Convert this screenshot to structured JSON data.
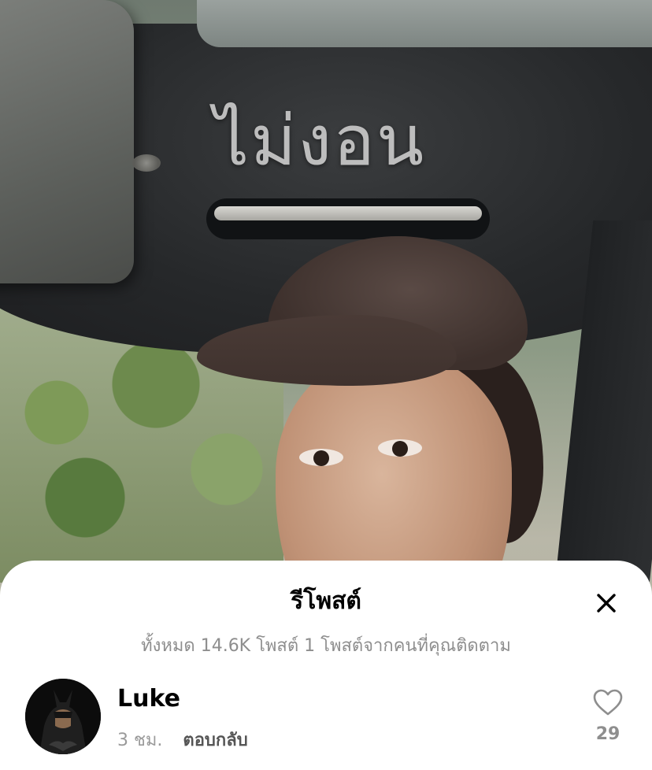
{
  "video": {
    "overlay_text": "ไม่งอน"
  },
  "sheet": {
    "title": "รีโพสต์",
    "close_icon": "close-icon",
    "subtitle": "ทั้งหมด 14.6K โพสต์ 1 โพสต์จากคนที่คุณติดตาม"
  },
  "reposts": [
    {
      "username": "Luke",
      "avatar_icon": "batman-avatar",
      "time_ago": "3 ชม.",
      "reply_label": "ตอบกลับ",
      "likes": "29",
      "like_icon": "heart-icon"
    }
  ],
  "colors": {
    "sheet_background": "#ffffff",
    "subtitle_text": "#8e8e8e",
    "overlay_text": "#bdbdbd"
  }
}
